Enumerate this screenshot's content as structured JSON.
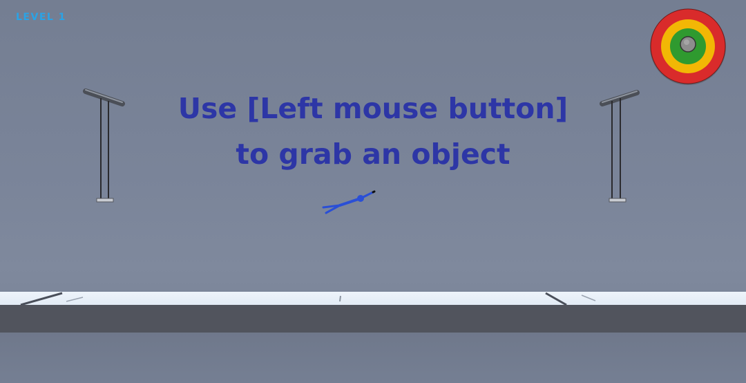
{
  "hud": {
    "level_label": "LEVEL 1"
  },
  "tutorial": {
    "line1": "Use [Left mouse button]",
    "line2": "to grab an object"
  },
  "colors": {
    "instruction_text": "#2d36a6",
    "level_text": "#2aa3e6",
    "target_outer": "#d92b2b",
    "target_middle": "#f2b705",
    "target_inner": "#2f9a2f",
    "target_center": "#8a8a8a",
    "ragdoll": "#2a4fd6",
    "floor_top": "#eef4fb",
    "floor_front": "#51545d"
  },
  "icons": {
    "target": "bullseye-target-icon",
    "character": "ragdoll-stickman"
  }
}
